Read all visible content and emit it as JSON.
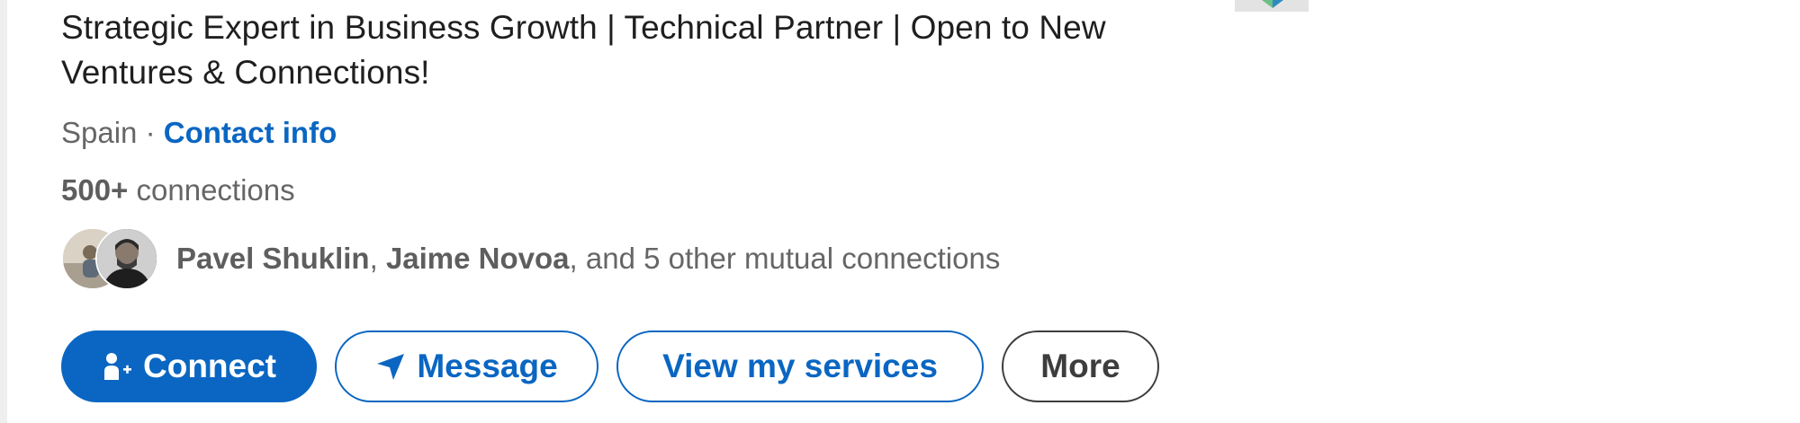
{
  "profile": {
    "headline": "Strategic Expert in Business Growth | Technical Partner | Open to New Ventures & Connections!",
    "location": "Spain",
    "separator": "·",
    "contact_info_label": "Contact info",
    "connections_count": "500+",
    "connections_label": "connections"
  },
  "mutual": {
    "name_1": "Pavel Shuklin",
    "sep_1": ",",
    "name_2": "Jaime Novoa",
    "suffix": ", and 5 other mutual connections"
  },
  "actions": {
    "connect_label": "Connect",
    "message_label": "Message",
    "services_label": "View my services",
    "more_label": "More"
  },
  "icons": {
    "connect_icon": "person-add-icon",
    "message_icon": "send-icon"
  },
  "colors": {
    "accent": "#0a66c2",
    "text_primary": "#1f1f1f",
    "text_secondary": "#666666",
    "more_border": "#3d3d3d"
  }
}
